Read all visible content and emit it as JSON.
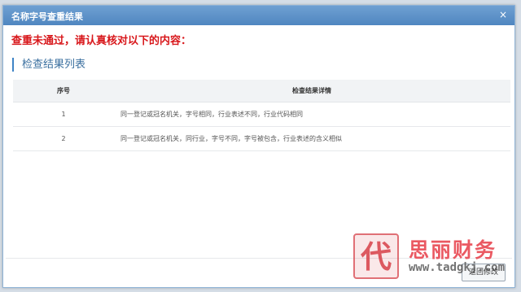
{
  "dialog": {
    "title": "名称字号查重结果",
    "close_glyph": "×"
  },
  "alert_text": "查重未通过，请认真核对以下的内容：",
  "section_title": "检查结果列表",
  "table": {
    "headers": [
      "序号",
      "检查结果详情"
    ],
    "rows": [
      {
        "no": "1",
        "detail": "同一登记或冠名机关，字号相同，行业表述不同，行业代码相同"
      },
      {
        "no": "2",
        "detail": "同一登记或冠名机关，同行业，字号不同，字号被包含，行业表述的含义相似"
      }
    ]
  },
  "footer": {
    "confirm_label": "返回修改"
  },
  "watermark": {
    "name": "思丽财务",
    "url": "www.tadgkj.com",
    "logo_char": "代"
  },
  "colors": {
    "titlebar": "#5b90c8",
    "alert": "#d8171b",
    "section_accent": "#3f84c6",
    "watermark": "#e63c46"
  }
}
